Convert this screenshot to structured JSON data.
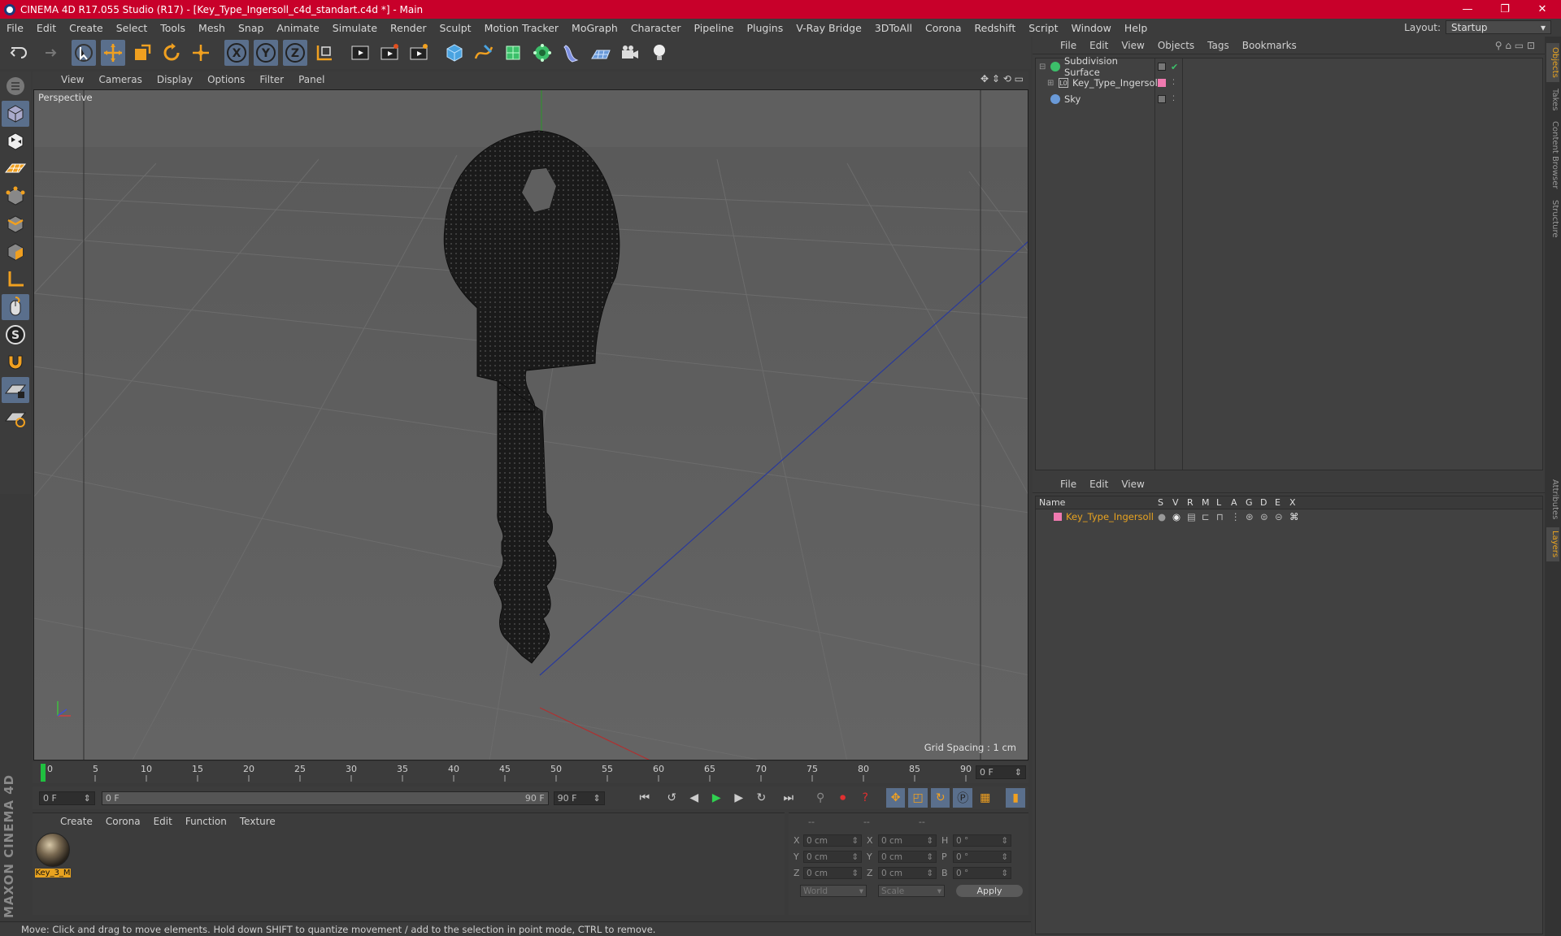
{
  "window": {
    "title": "CINEMA 4D R17.055 Studio (R17) - [Key_Type_Ingersoll_c4d_standart.c4d *] - Main",
    "controls": [
      "—",
      "❐",
      "✕"
    ]
  },
  "menubar": {
    "items": [
      "File",
      "Edit",
      "Create",
      "Select",
      "Tools",
      "Mesh",
      "Snap",
      "Animate",
      "Simulate",
      "Render",
      "Sculpt",
      "Motion Tracker",
      "MoGraph",
      "Character",
      "Pipeline",
      "Plugins",
      "V-Ray Bridge",
      "3DToAll",
      "Corona",
      "Redshift",
      "Script",
      "Window",
      "Help"
    ],
    "layout_label": "Layout:",
    "layout_value": "Startup"
  },
  "toolbar": {
    "icons": [
      "undo-icon",
      "redo-icon",
      "select-arrow-icon",
      "move-icon",
      "scale-icon",
      "rotate-icon",
      "transform-icon",
      "x-axis-icon",
      "y-axis-icon",
      "z-axis-icon",
      "coordinate-system-icon",
      "render-view-icon",
      "render-picture-viewer-icon",
      "edit-render-settings-icon",
      "cube-primitive-icon",
      "spline-pen-icon",
      "subdivision-generator-icon",
      "cloner-icon",
      "deformer-icon",
      "floor-environment-icon",
      "camera-icon",
      "light-icon"
    ]
  },
  "viewport": {
    "menu": [
      "View",
      "Cameras",
      "Display",
      "Options",
      "Filter",
      "Panel"
    ],
    "label": "Perspective",
    "grid_spacing": "Grid Spacing : 1 cm"
  },
  "timeline": {
    "ticks": [
      "0",
      "5",
      "10",
      "15",
      "20",
      "25",
      "30",
      "35",
      "40",
      "45",
      "50",
      "55",
      "60",
      "65",
      "70",
      "75",
      "80",
      "85",
      "90"
    ],
    "current_frame": "0 F",
    "start_field": "0 F",
    "range_start": "0 F",
    "range_end": "90 F",
    "end_field": "90 F"
  },
  "material_panel": {
    "menu": [
      "Create",
      "Corona",
      "Edit",
      "Function",
      "Texture"
    ],
    "material_name": "Key_3_M"
  },
  "coordinates": {
    "header": [
      "--",
      "--",
      "--"
    ],
    "rows": [
      {
        "a": "X",
        "av": "0 cm",
        "b": "X",
        "bv": "0 cm",
        "c": "H",
        "cv": "0 °"
      },
      {
        "a": "Y",
        "av": "0 cm",
        "b": "Y",
        "bv": "0 cm",
        "c": "P",
        "cv": "0 °"
      },
      {
        "a": "Z",
        "av": "0 cm",
        "b": "Z",
        "bv": "0 cm",
        "c": "B",
        "cv": "0 °"
      }
    ],
    "mode_world": "World",
    "mode_scale": "Scale",
    "apply": "Apply"
  },
  "statusbar": {
    "text": "Move: Click and drag to move elements. Hold down SHIFT to quantize movement / add to the selection in point mode, CTRL to remove."
  },
  "object_manager": {
    "menu": [
      "File",
      "Edit",
      "View",
      "Objects",
      "Tags",
      "Bookmarks"
    ],
    "objects": [
      {
        "name": "Subdivision Surface"
      },
      {
        "name": "Key_Type_Ingersoll"
      },
      {
        "name": "Sky"
      }
    ]
  },
  "layer_manager": {
    "menu": [
      "File",
      "Edit",
      "View"
    ],
    "columns": [
      "Name",
      "S",
      "V",
      "R",
      "M",
      "L",
      "A",
      "G",
      "D",
      "E",
      "X"
    ],
    "layer_name": "Key_Type_Ingersoll"
  },
  "side_tabs": [
    "Objects",
    "Takes",
    "Content Browser",
    "Structure",
    "Attributes",
    "Layers"
  ],
  "branding": "MAXON CINEMA 4D",
  "colors": {
    "titlebar": "#c8002a",
    "accent_orange": "#e8a320",
    "highlight_blue": "#5a6f8c",
    "layer_pink": "#f07ab0"
  }
}
